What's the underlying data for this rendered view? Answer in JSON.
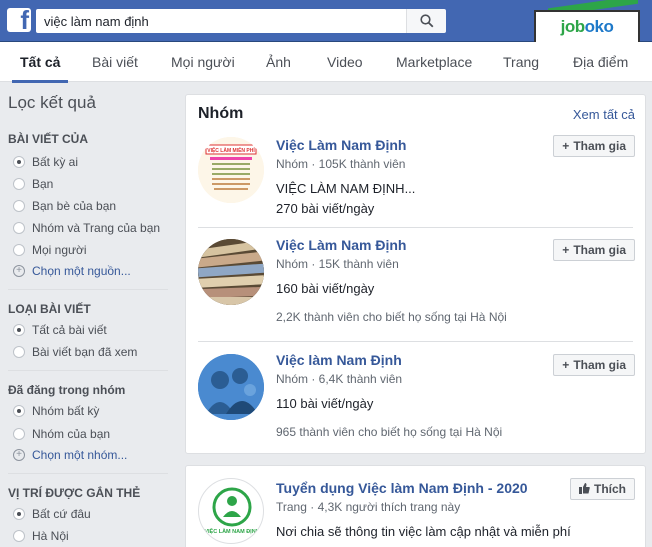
{
  "search": {
    "value": "việc làm nam định"
  },
  "logo": {
    "brand_left": "job",
    "brand_right": "oko"
  },
  "tabs": [
    {
      "label": "Tất cả"
    },
    {
      "label": "Bài viết"
    },
    {
      "label": "Mọi người"
    },
    {
      "label": "Ảnh"
    },
    {
      "label": "Video"
    },
    {
      "label": "Marketplace"
    },
    {
      "label": "Trang"
    },
    {
      "label": "Địa điểm"
    }
  ],
  "sidebar": {
    "title": "Lọc kết quả",
    "sections": [
      {
        "heading": "BÀI VIẾT CỦA",
        "options": [
          "Bất kỳ ai",
          "Bạn",
          "Bạn bè của bạn",
          "Nhóm và Trang của bạn",
          "Mọi người"
        ],
        "more": "Chọn một nguồn..."
      },
      {
        "heading": "LOẠI BÀI VIẾT",
        "options": [
          "Tất cả bài viết",
          "Bài viết bạn đã xem"
        ]
      },
      {
        "heading": "Đã đăng trong nhóm",
        "options": [
          "Nhóm bất kỳ",
          "Nhóm của bạn"
        ],
        "more": "Chọn một nhóm..."
      },
      {
        "heading": "VỊ TRÍ ĐƯỢC GẮN THẺ",
        "options": [
          "Bất cứ đâu",
          "Hà Nội"
        ]
      }
    ]
  },
  "groups_card": {
    "title": "Nhóm",
    "see_all": "Xem tất cả",
    "join_label": "Tham gia",
    "items": [
      {
        "name": "Việc Làm Nam Định",
        "meta": "Nhóm · 105K thành viên",
        "desc": "VIỆC LÀM NAM ĐỊNH...",
        "posts": "270 bài viết/ngày",
        "extra": ""
      },
      {
        "name": "Việc Làm Nam Định",
        "meta": "Nhóm · 15K thành viên",
        "desc": "",
        "posts": "160 bài viết/ngày",
        "extra": "2,2K thành viên cho biết họ sống tại Hà Nội"
      },
      {
        "name": "Việc làm Nam Định",
        "meta": "Nhóm · 6,4K thành viên",
        "desc": "",
        "posts": "110 bài viết/ngày",
        "extra": "965 thành viên cho biết họ sống tại Hà Nội"
      }
    ]
  },
  "page_card": {
    "name": "Tuyển dụng Việc làm Nam Định - 2020",
    "meta": "Trang · 4,3K người thích trang này",
    "desc": "Nơi chia sẽ thông tin việc làm cập nhật và miễn phí",
    "like_label": "Thích",
    "avatar_text": "VIỆC LÀM NAM ĐỊNH"
  },
  "avatar1_text": "VIỆC LÀM MIỄN PHÍ"
}
